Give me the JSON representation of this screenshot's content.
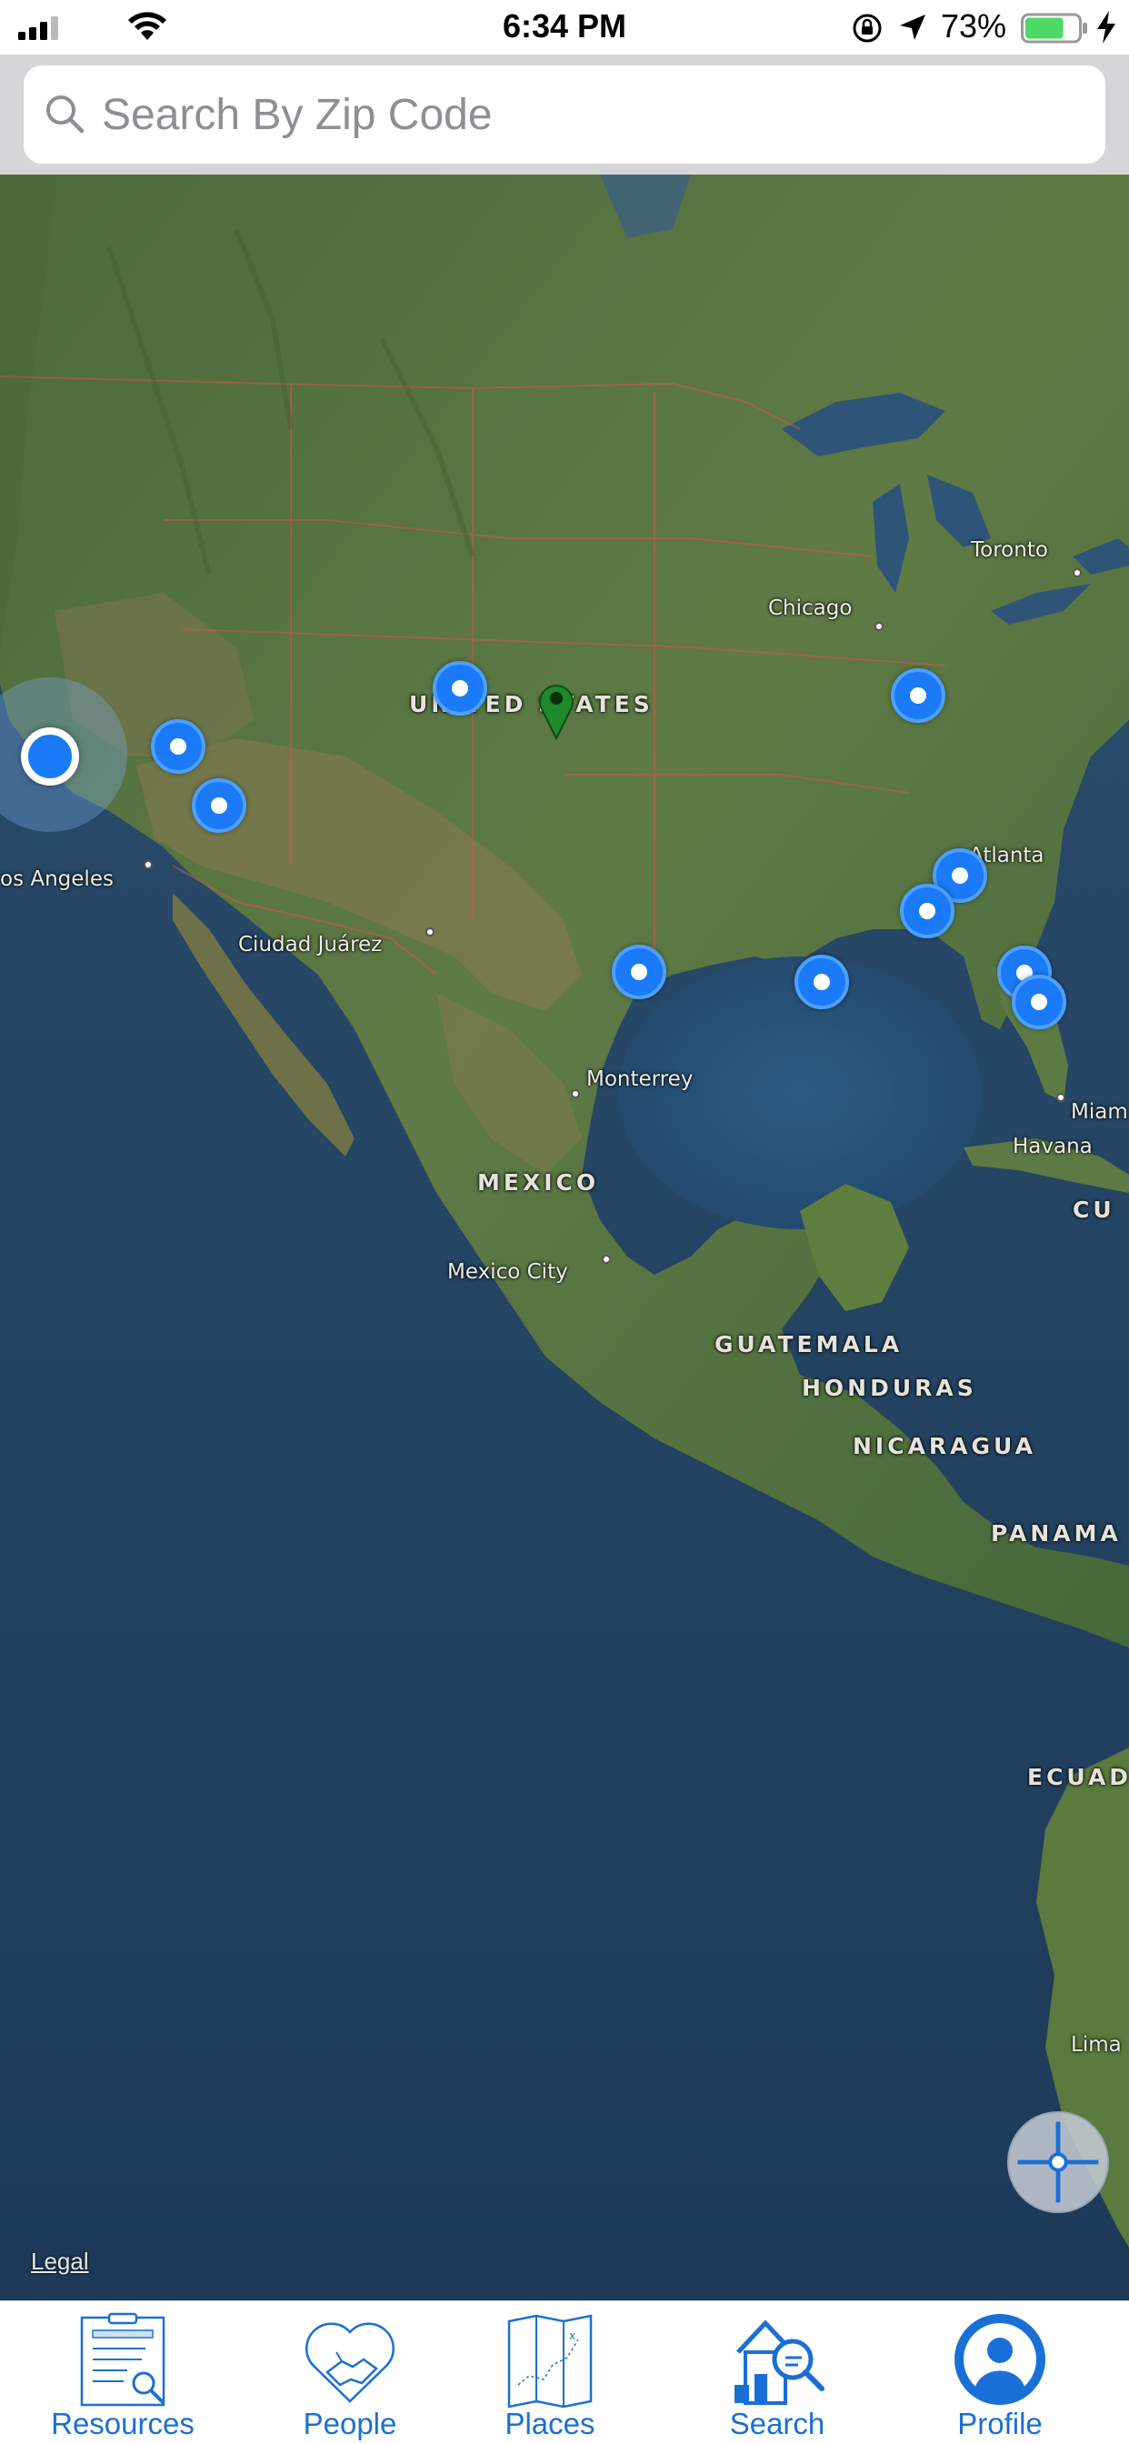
{
  "status_bar": {
    "time": "6:34 PM",
    "battery_percent": "73%",
    "battery_level": 0.73,
    "battery_color": "#4cd964"
  },
  "search": {
    "placeholder": "Search By Zip Code",
    "value": ""
  },
  "map": {
    "labels": {
      "toronto": "Toronto",
      "chicago": "Chicago",
      "united_states": "UNITED STATES",
      "atlanta": "Atlanta",
      "los_angeles": "os Angeles",
      "ciudad_juarez": "Ciudad Juárez",
      "monterrey": "Monterrey",
      "mexico": "MEXICO",
      "mexico_city": "Mexico City",
      "miami": "Miam",
      "havana": "Havana",
      "cuba": "CU",
      "guatemala": "GUATEMALA",
      "honduras": "HONDURAS",
      "nicaragua": "NICARAGUA",
      "panama": "PANAMA",
      "ecuador": "ECUAD",
      "lima": "Lima"
    },
    "legal": "Legal",
    "pin_color": "#1a7af8",
    "selected_pin_color": "#1e8a2a"
  },
  "tabs": [
    {
      "label": "Resources",
      "icon": "clipboard-search-icon"
    },
    {
      "label": "People",
      "icon": "heart-handshake-icon"
    },
    {
      "label": "Places",
      "icon": "folded-map-icon"
    },
    {
      "label": "Search",
      "icon": "house-search-icon"
    },
    {
      "label": "Profile",
      "icon": "profile-icon"
    }
  ],
  "accent_color": "#1a6fd6"
}
